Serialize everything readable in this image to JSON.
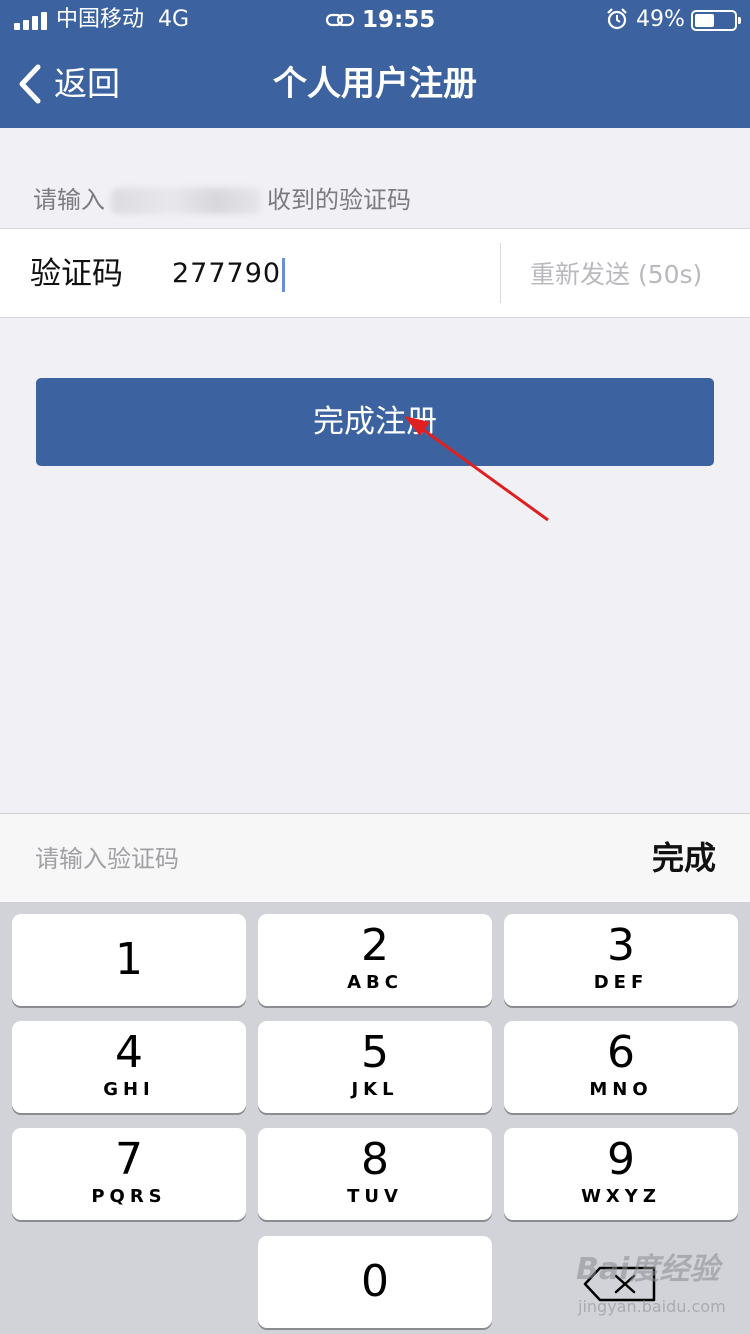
{
  "status_bar": {
    "carrier": "中国移动",
    "network": "4G",
    "time": "19:55",
    "battery_percent": "49%",
    "battery_level": 0.49,
    "icons": [
      "signal-icon",
      "link-icon",
      "alarm-icon",
      "battery-icon"
    ]
  },
  "nav": {
    "back_label": "返回",
    "title": "个人用户注册"
  },
  "form": {
    "hint_prefix": "请输入",
    "hint_suffix": "收到的验证码",
    "code_label": "验证码",
    "code_value": "277790",
    "resend_label": "重新发送 (50s)",
    "submit_label": "完成注册"
  },
  "accessory": {
    "hint": "请输入验证码",
    "done_label": "完成"
  },
  "keypad": {
    "keys": [
      {
        "digit": "1",
        "letters": ""
      },
      {
        "digit": "2",
        "letters": "ABC"
      },
      {
        "digit": "3",
        "letters": "DEF"
      },
      {
        "digit": "4",
        "letters": "GHI"
      },
      {
        "digit": "5",
        "letters": "JKL"
      },
      {
        "digit": "6",
        "letters": "MNO"
      },
      {
        "digit": "7",
        "letters": "PQRS"
      },
      {
        "digit": "8",
        "letters": "TUV"
      },
      {
        "digit": "9",
        "letters": "WXYZ"
      },
      {
        "digit": "0",
        "letters": ""
      }
    ]
  },
  "watermark": {
    "brand": "Bai度经验",
    "url": "jingyan.baidu.com"
  },
  "colors": {
    "brand_blue": "#3c63a0",
    "background": "#f0f0f5",
    "annotation_arrow": "#e02020"
  }
}
